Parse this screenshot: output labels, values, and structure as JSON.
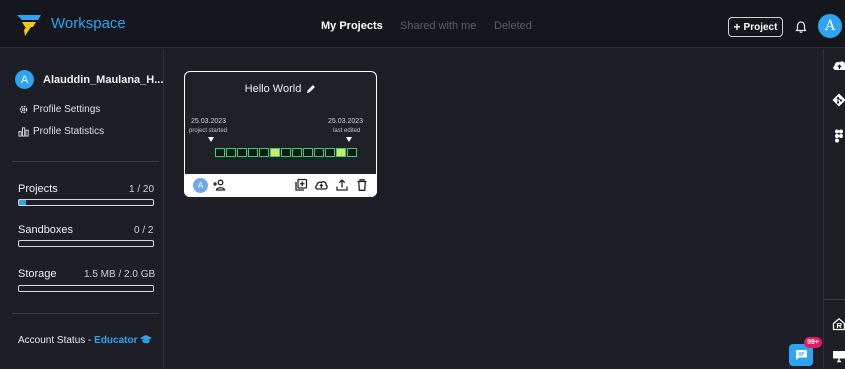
{
  "app": {
    "brand": "Workspace",
    "accent_color": "#2ea3f2"
  },
  "nav": {
    "tabs": [
      {
        "label": "My Projects",
        "active": true
      },
      {
        "label": "Shared with me",
        "active": false
      },
      {
        "label": "Deleted",
        "active": false
      }
    ],
    "new_project_label": "Project",
    "user_initial": "A"
  },
  "sidebar": {
    "user_initial": "A",
    "user_name": "Alauddin_Maulana_H...",
    "links": [
      {
        "label": "Profile Settings",
        "icon": "gear-icon"
      },
      {
        "label": "Profile Statistics",
        "icon": "bar-chart-icon"
      }
    ],
    "meters": [
      {
        "label": "Projects",
        "value_text": "1 / 20",
        "fraction": 0.05
      },
      {
        "label": "Sandboxes",
        "value_text": "0 / 2",
        "fraction": 0.0
      },
      {
        "label": "Storage",
        "value_text": "1.5 MB / 2.0 GB",
        "fraction": 0.0
      }
    ],
    "account_status_label": "Account Status - ",
    "account_status_value": "Educator"
  },
  "project_card": {
    "title": "Hello World",
    "started_date": "25.03.2023",
    "started_label": "project started",
    "edited_date": "25.03.2023",
    "edited_label": "last edited",
    "activity": [
      0,
      0,
      0,
      0,
      0,
      1,
      0,
      0,
      0,
      0,
      0,
      1,
      0
    ]
  },
  "chat": {
    "badge": "99+"
  }
}
